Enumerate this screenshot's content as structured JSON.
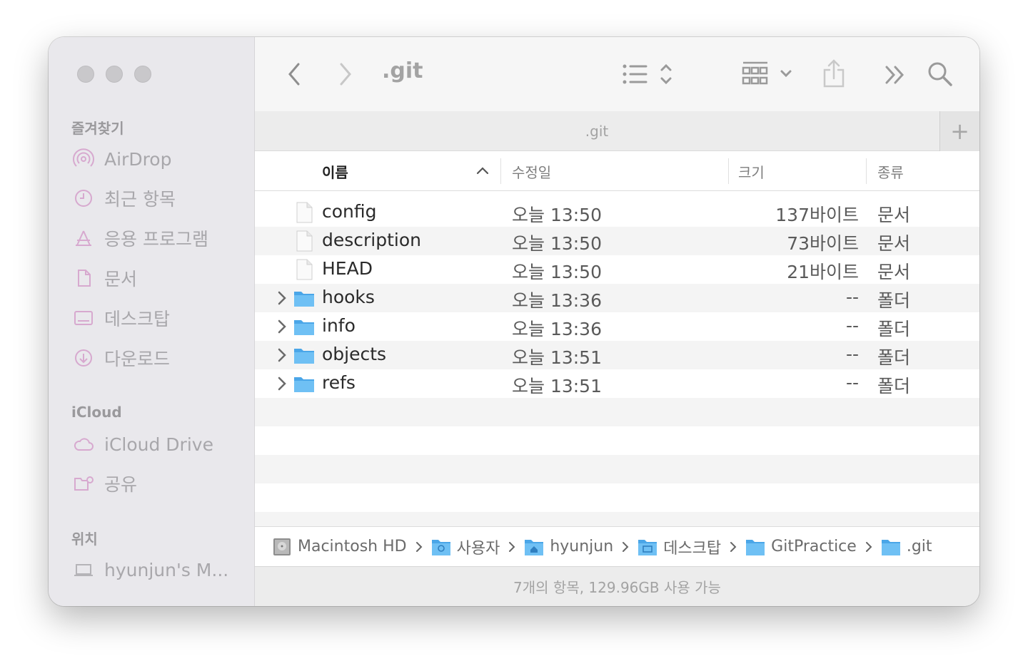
{
  "window": {
    "title": ".git"
  },
  "sidebar": {
    "sections": [
      {
        "label": "즐겨찾기",
        "items": [
          {
            "label": "AirDrop",
            "icon": "airdrop-icon"
          },
          {
            "label": "최근 항목",
            "icon": "clock-icon"
          },
          {
            "label": "응용 프로그램",
            "icon": "applications-icon"
          },
          {
            "label": "문서",
            "icon": "document-icon"
          },
          {
            "label": "데스크탑",
            "icon": "desktop-icon"
          },
          {
            "label": "다운로드",
            "icon": "download-icon"
          }
        ]
      },
      {
        "label": "iCloud",
        "items": [
          {
            "label": "iCloud Drive",
            "icon": "cloud-icon"
          },
          {
            "label": "공유",
            "icon": "shared-folder-icon"
          }
        ]
      },
      {
        "label": "위치",
        "items": [
          {
            "label": "hyunjun's M...",
            "icon": "laptop-icon"
          }
        ]
      }
    ]
  },
  "toolbar": {
    "title": ".git"
  },
  "tab": {
    "title": ".git",
    "add_label": "+"
  },
  "columns": {
    "name": "이름",
    "date": "수정일",
    "size": "크기",
    "kind": "종류"
  },
  "files": [
    {
      "name": "config",
      "date": "오늘 13:50",
      "size": "137바이트",
      "kind": "문서",
      "type": "file"
    },
    {
      "name": "description",
      "date": "오늘 13:50",
      "size": "73바이트",
      "kind": "문서",
      "type": "file"
    },
    {
      "name": "HEAD",
      "date": "오늘 13:50",
      "size": "21바이트",
      "kind": "문서",
      "type": "file"
    },
    {
      "name": "hooks",
      "date": "오늘 13:36",
      "size": "--",
      "kind": "폴더",
      "type": "folder"
    },
    {
      "name": "info",
      "date": "오늘 13:36",
      "size": "--",
      "kind": "폴더",
      "type": "folder"
    },
    {
      "name": "objects",
      "date": "오늘 13:51",
      "size": "--",
      "kind": "폴더",
      "type": "folder"
    },
    {
      "name": "refs",
      "date": "오늘 13:51",
      "size": "--",
      "kind": "폴더",
      "type": "folder"
    }
  ],
  "path": [
    {
      "label": "Macintosh HD",
      "icon": "hard-drive-icon"
    },
    {
      "label": "사용자",
      "icon": "users-folder-icon"
    },
    {
      "label": "hyunjun",
      "icon": "home-folder-icon"
    },
    {
      "label": "데스크탑",
      "icon": "desktop-folder-icon"
    },
    {
      "label": "GitPractice",
      "icon": "folder-icon"
    },
    {
      "label": ".git",
      "icon": "folder-icon"
    }
  ],
  "status": "7개의 항목, 129.96GB 사용 가능",
  "colors": {
    "folder": "#5db7f0",
    "sidebar_icon": "#d7a9cf",
    "sidebar_bg": "#e9e8ec"
  }
}
